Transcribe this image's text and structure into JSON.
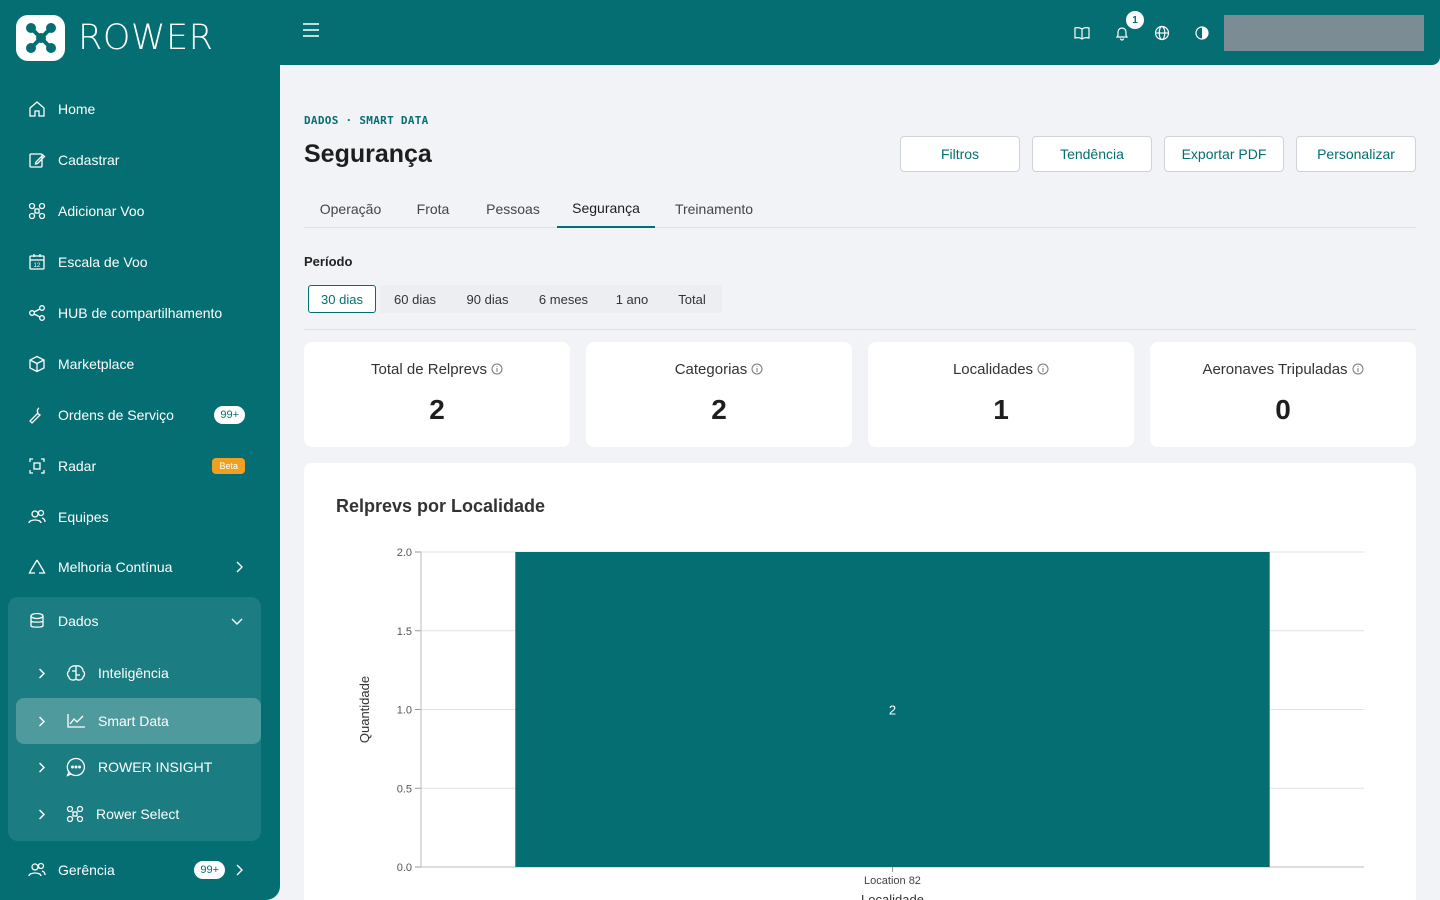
{
  "app": {
    "logo_text": "ROWER"
  },
  "sidebar": {
    "items": [
      {
        "label": "Home",
        "icon": "home-icon"
      },
      {
        "label": "Cadastrar",
        "icon": "edit-icon"
      },
      {
        "label": "Adicionar Voo",
        "icon": "drone-icon"
      },
      {
        "label": "Escala de Voo",
        "icon": "calendar-icon"
      },
      {
        "label": "HUB de compartilhamento",
        "icon": "share-icon"
      },
      {
        "label": "Marketplace",
        "icon": "box-icon"
      },
      {
        "label": "Ordens de Serviço",
        "icon": "wrench-icon",
        "badge": "99+"
      },
      {
        "label": "Radar",
        "icon": "radar-icon",
        "badge": "Beta"
      },
      {
        "label": "Equipes",
        "icon": "users-icon"
      },
      {
        "label": "Melhoria Contínua",
        "icon": "recycle-icon"
      },
      {
        "label": "Dados",
        "icon": "database-icon"
      },
      {
        "label": "Gerência",
        "icon": "users-icon",
        "badge": "99+"
      }
    ],
    "sub_items": [
      {
        "label": "Inteligência",
        "icon": "brain-icon"
      },
      {
        "label": "Smart Data",
        "icon": "chart-line-icon"
      },
      {
        "label": "ROWER INSIGHT",
        "icon": "chat-icon"
      },
      {
        "label": "Rower Select",
        "icon": "drone-icon"
      }
    ]
  },
  "topbar": {
    "notification_count": "1"
  },
  "page": {
    "breadcrumb": "DADOS · SMART DATA",
    "title": "Segurança",
    "buttons": [
      "Filtros",
      "Tendência",
      "Exportar PDF",
      "Personalizar"
    ],
    "tabs": [
      "Operação",
      "Frota",
      "Pessoas",
      "Segurança",
      "Treinamento"
    ],
    "active_tab": "Segurança",
    "periodo_label": "Período",
    "periods": [
      "30 dias",
      "60 dias",
      "90 dias",
      "6 meses",
      "1 ano",
      "Total"
    ],
    "active_period": "30 dias",
    "cards": [
      {
        "label": "Total de Relprevs",
        "value": "2"
      },
      {
        "label": "Categorias",
        "value": "2"
      },
      {
        "label": "Localidades",
        "value": "1"
      },
      {
        "label": "Aeronaves Tripuladas",
        "value": "0"
      }
    ]
  },
  "colors": {
    "brand": "#046e72",
    "bar": "#046e72"
  },
  "chart_data": {
    "type": "bar",
    "title": "Relprevs por Localidade",
    "categories": [
      "Location 82"
    ],
    "values": [
      2
    ],
    "data_labels": [
      "2"
    ],
    "ylabel": "Quantidade",
    "xlabel": "Localidade",
    "ylim": [
      0,
      2
    ],
    "yticks": [
      "0.0",
      "0.5",
      "1.0",
      "1.5",
      "2.0"
    ],
    "grid": true
  }
}
